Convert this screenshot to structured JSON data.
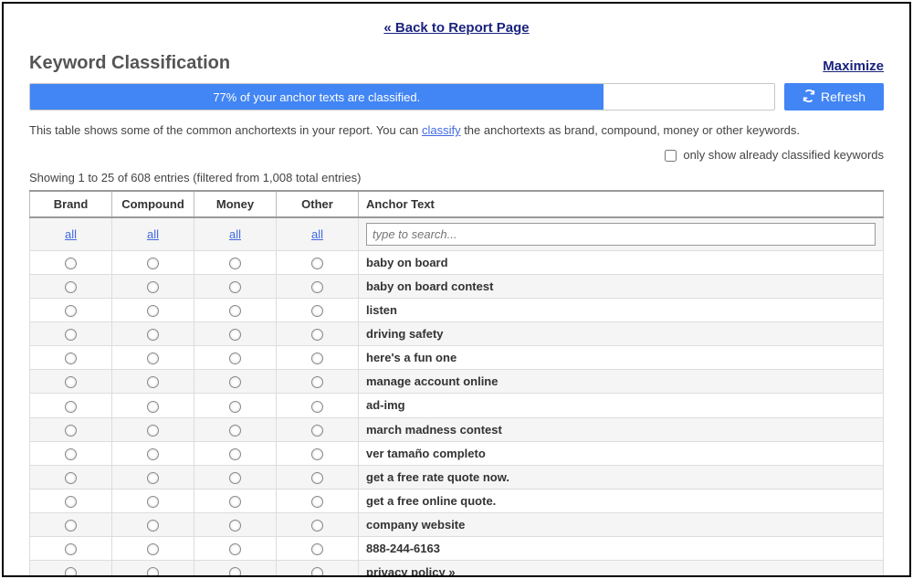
{
  "back_link": "« Back to Report Page",
  "section_title": "Keyword Classification",
  "maximize": "Maximize",
  "progress": {
    "percent": 77,
    "text": "77% of your anchor texts are classified."
  },
  "refresh_label": "Refresh",
  "description_pre": "This table shows some of the common anchortexts in your report. You can ",
  "description_link": "classify",
  "description_post": " the anchortexts as brand, compound, money or other keywords.",
  "only_classified_label": "only show already classified keywords",
  "showing_text": "Showing 1 to 25 of 608 entries (filtered from 1,008 total entries)",
  "columns": {
    "brand": "Brand",
    "compound": "Compound",
    "money": "Money",
    "other": "Other",
    "anchor": "Anchor Text"
  },
  "all_label": "all",
  "search_placeholder": "type to search...",
  "rows": [
    {
      "anchor": "baby on board"
    },
    {
      "anchor": "baby on board contest"
    },
    {
      "anchor": "listen"
    },
    {
      "anchor": "driving safety"
    },
    {
      "anchor": "here's a fun one"
    },
    {
      "anchor": "manage account online"
    },
    {
      "anchor": "ad-img"
    },
    {
      "anchor": "march madness contest"
    },
    {
      "anchor": "ver tamaño completo"
    },
    {
      "anchor": "get a free rate quote now."
    },
    {
      "anchor": "get a free online quote."
    },
    {
      "anchor": "company website"
    },
    {
      "anchor": "888-244-6163"
    },
    {
      "anchor": "privacy policy »"
    }
  ]
}
